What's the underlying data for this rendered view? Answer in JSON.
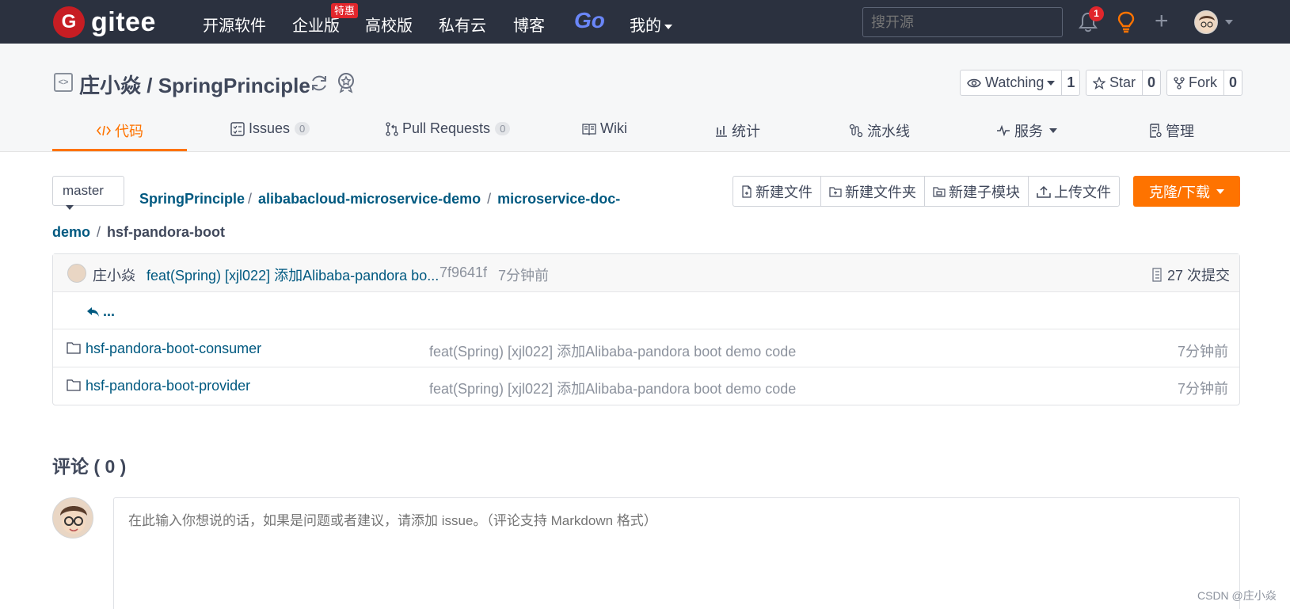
{
  "nav": {
    "logo_text": "gitee",
    "logo_badge": "G",
    "links": [
      "开源软件",
      "企业版",
      "高校版",
      "私有云",
      "博客"
    ],
    "hot_badge": "特惠",
    "go": "Go",
    "mine": "我的",
    "search_placeholder": "搜开源",
    "notif_count": "1"
  },
  "repo": {
    "owner": "庄小焱",
    "name": "SpringPrinciple",
    "sep": " / ",
    "watch": {
      "label": "Watching",
      "count": "1"
    },
    "star": {
      "label": "Star",
      "count": "0"
    },
    "fork": {
      "label": "Fork",
      "count": "0"
    }
  },
  "tabs": [
    {
      "label": "代码"
    },
    {
      "label": "Issues",
      "badge": "0"
    },
    {
      "label": "Pull Requests",
      "badge": "0"
    },
    {
      "label": "Wiki"
    },
    {
      "label": "统计"
    },
    {
      "label": "流水线"
    },
    {
      "label": "服务"
    },
    {
      "label": "管理"
    }
  ],
  "toolbar": {
    "branch": "master",
    "breadcrumb": [
      "SpringPrinciple",
      "alibabacloud-microservice-demo",
      "microservice-doc-demo"
    ],
    "current": "hsf-pandora-boot",
    "actions": [
      "新建文件",
      "新建文件夹",
      "新建子模块",
      "上传文件"
    ],
    "clone": "克隆/下载"
  },
  "commit": {
    "author": "庄小焱",
    "message": "feat(Spring) [xjl022] 添加Alibaba-pandora bo...",
    "sha": "7f9641f",
    "time": "7分钟前",
    "count": "27 次提交"
  },
  "up_label": "...",
  "files": [
    {
      "name": "hsf-pandora-boot-consumer",
      "message": "feat(Spring) [xjl022] 添加Alibaba-pandora boot demo code",
      "time": "7分钟前"
    },
    {
      "name": "hsf-pandora-boot-provider",
      "message": "feat(Spring) [xjl022] 添加Alibaba-pandora boot demo code",
      "time": "7分钟前"
    }
  ],
  "comments": {
    "title": "评论 ( 0 )",
    "placeholder": "在此输入你想说的话，如果是问题或者建议，请添加 issue。（评论支持 Markdown 格式）"
  },
  "watermark": "CSDN @庄小焱",
  "colors": {
    "accent": "#fe7300",
    "nav_bg": "#2b313f",
    "link": "#005980"
  }
}
